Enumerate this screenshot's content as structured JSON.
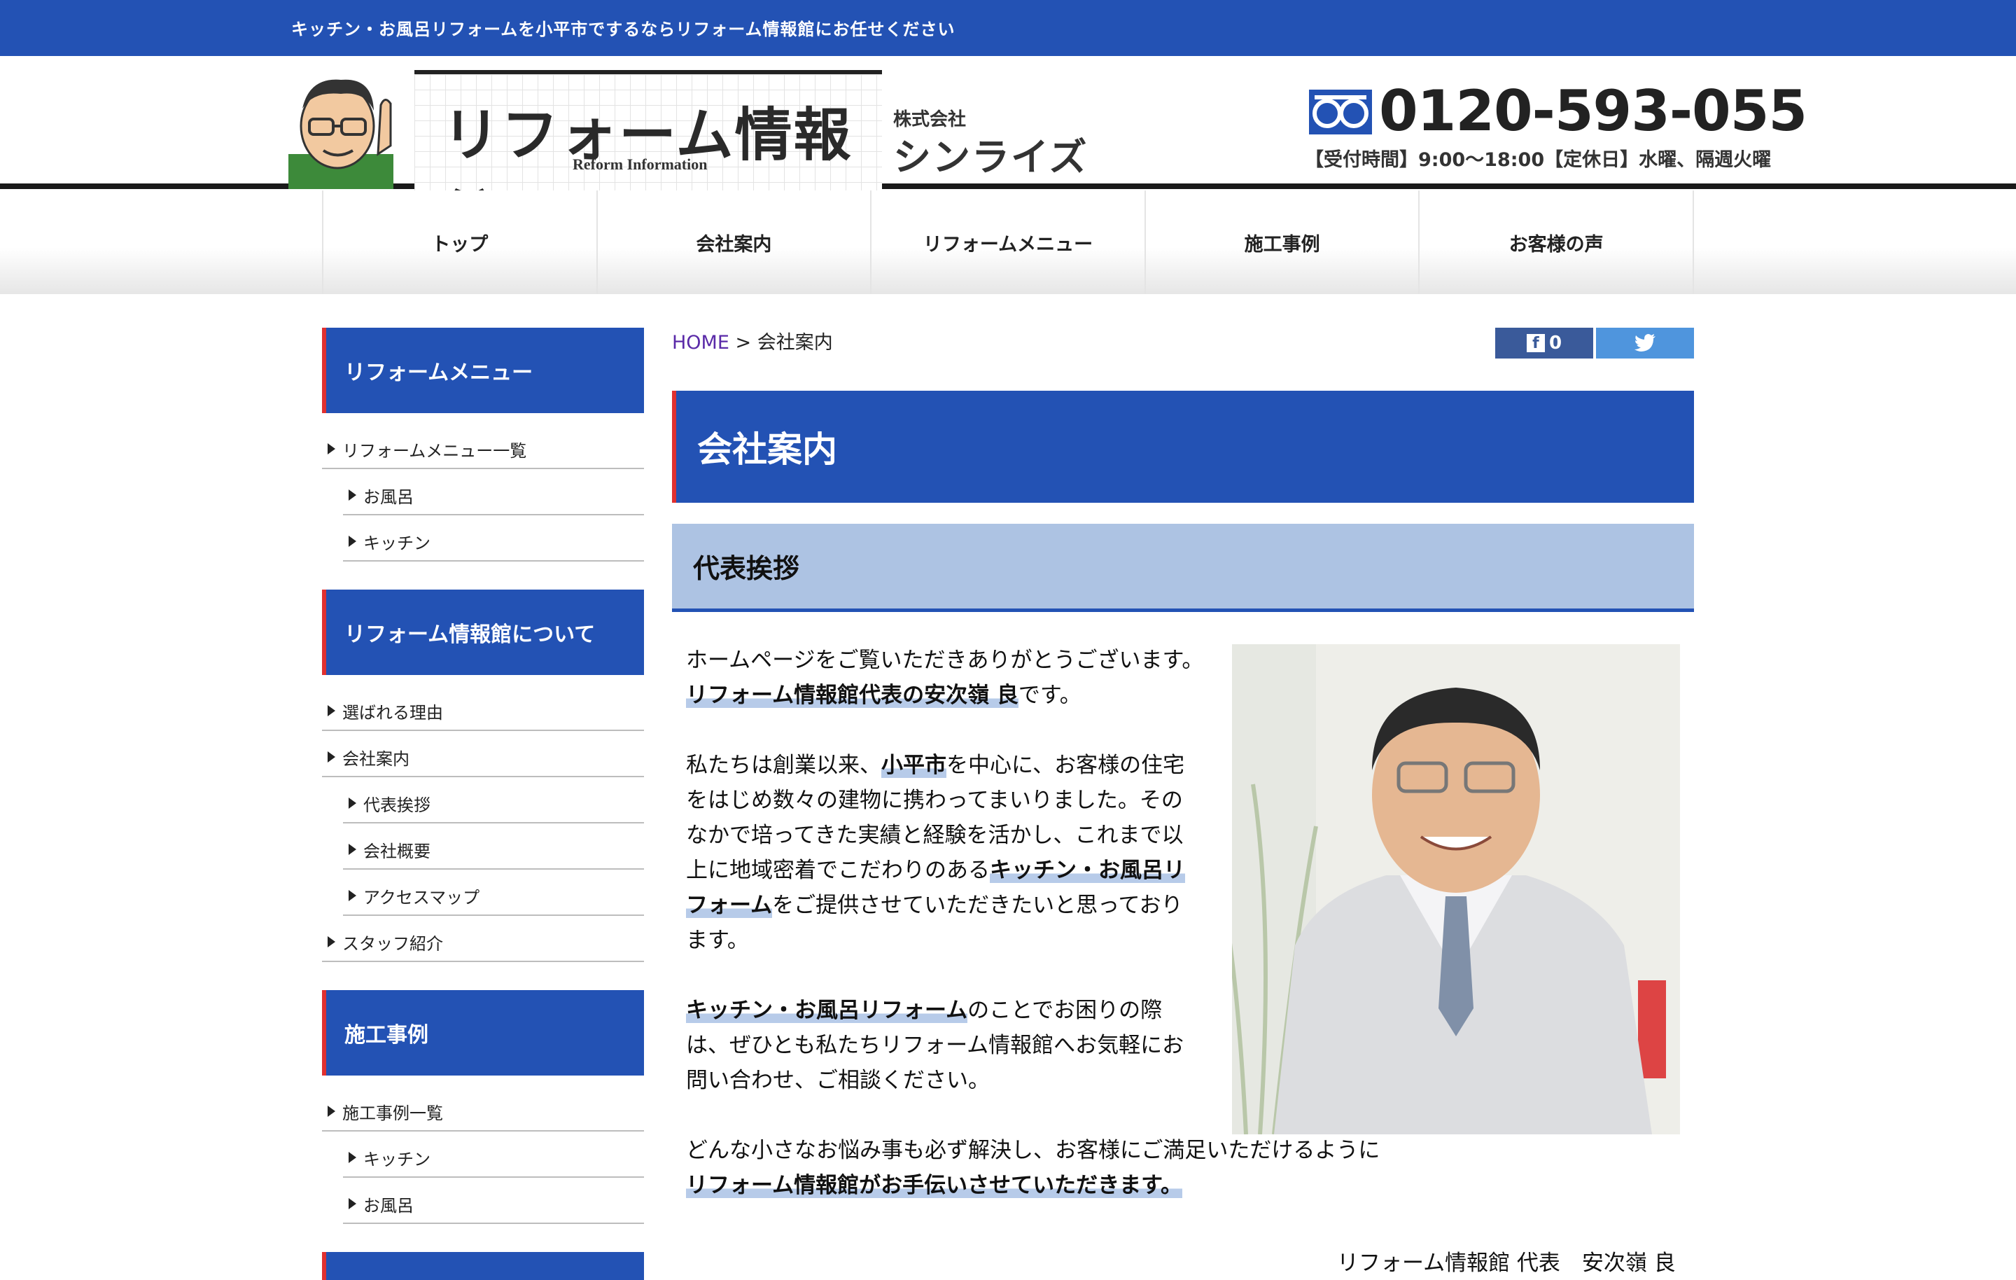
{
  "topbar": {
    "text": "キッチン・お風呂リフォームを小平市でするならリフォーム情報館にお任せください"
  },
  "header": {
    "logo_title": "リフォーム情報館",
    "logo_sub": "Reform Information",
    "company_small": "株式会社",
    "company_big": "シンライズ",
    "phone": "0120-593-055",
    "hours": "【受付時間】9:00〜18:00【定休日】水曜、隔週火曜"
  },
  "nav": {
    "items": [
      "トップ",
      "会社案内",
      "リフォームメニュー",
      "施工事例",
      "お客様の声"
    ]
  },
  "sidebar": {
    "sections": [
      {
        "title": "リフォームメニュー",
        "items": [
          {
            "label": "リフォームメニュー一覧",
            "sub": false
          },
          {
            "label": "お風呂",
            "sub": true
          },
          {
            "label": "キッチン",
            "sub": true
          }
        ]
      },
      {
        "title": "リフォーム情報館について",
        "items": [
          {
            "label": "選ばれる理由",
            "sub": false
          },
          {
            "label": "会社案内",
            "sub": false
          },
          {
            "label": "代表挨拶",
            "sub": true
          },
          {
            "label": "会社概要",
            "sub": true
          },
          {
            "label": "アクセスマップ",
            "sub": true
          },
          {
            "label": "スタッフ紹介",
            "sub": false
          }
        ]
      },
      {
        "title": "施工事例",
        "items": [
          {
            "label": "施工事例一覧",
            "sub": false
          },
          {
            "label": "キッチン",
            "sub": true
          },
          {
            "label": "お風呂",
            "sub": true
          }
        ]
      }
    ]
  },
  "breadcrumb": {
    "home": "HOME",
    "sep": " > ",
    "current": "会社案内"
  },
  "social": {
    "fb_count": "0"
  },
  "main": {
    "page_title": "会社案内",
    "section_title": "代表挨拶",
    "p1a": "ホームページをご覧いただきありがとうございます。",
    "p1b": "リフォーム情報館代表の安次嶺 良",
    "p1c": "です。",
    "p2a": "私たちは創業以来、",
    "p2b": "小平市",
    "p2c": "を中心に、お客様の住宅をはじめ数々の建物に携わってまいりました。そのなかで培ってきた実績と経験を活かし、これまで以上に地域密着でこだわりのある",
    "p2d": "キッチン・お風呂リフォーム",
    "p2e": "をご提供させていただきたいと思っております。",
    "p3a": "キッチン・お風呂リフォーム",
    "p3b": "のことでお困りの際は、ぜひとも私たちリフォーム情報館へお気軽にお問い合わせ、ご相談ください。",
    "p4a": "どんな小さなお悩み事も必ず解決し、お客様にご満足いただけるように",
    "p4b": "リフォーム情報館がお手伝いさせていただきます。",
    "signature": "リフォーム情報館 代表　安次嶺 良"
  },
  "colors": {
    "brand": "#2352b4",
    "accent": "#e03030",
    "section_bg": "#adc3e3"
  }
}
